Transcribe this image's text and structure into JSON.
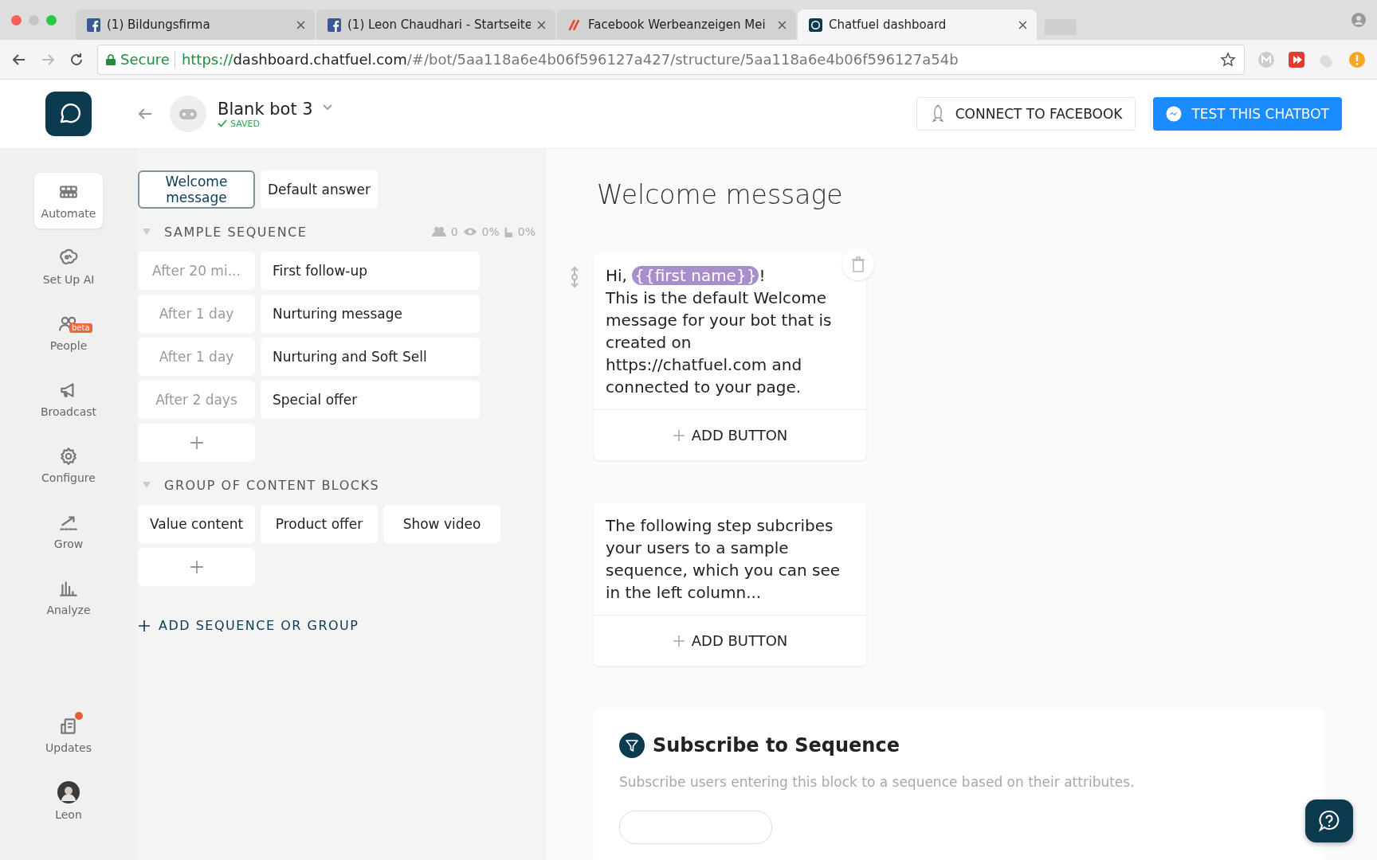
{
  "browser": {
    "tabs": [
      {
        "title": "(1) Bildungsfirma",
        "kind": "facebook",
        "selected": false
      },
      {
        "title": "(1) Leon Chaudhari - Startseite",
        "kind": "facebook",
        "selected": false
      },
      {
        "title": "Facebook Werbeanzeigen Mei",
        "kind": "adobe",
        "selected": false
      },
      {
        "title": "Chatfuel dashboard",
        "kind": "chatfuel",
        "selected": true
      }
    ],
    "secure_label": "Secure",
    "url_scheme": "https://",
    "url_host": "dashboard.chatfuel.com",
    "url_path": "/#/bot/5aa118a6e4b06f596127a427/structure/5aa118a6e4b06f596127a54b"
  },
  "header": {
    "bot_name": "Blank bot 3",
    "status": "SAVED",
    "connect_button": "CONNECT TO FACEBOOK",
    "test_button": "TEST THIS CHATBOT"
  },
  "sidebar": {
    "items": [
      {
        "label": "Automate",
        "kind": "automate",
        "selected": true
      },
      {
        "label": "Set Up AI",
        "kind": "ai",
        "selected": false
      },
      {
        "label": "People",
        "kind": "people",
        "selected": false,
        "badge": "beta"
      },
      {
        "label": "Broadcast",
        "kind": "broadcast",
        "selected": false
      },
      {
        "label": "Configure",
        "kind": "configure",
        "selected": false
      },
      {
        "label": "Grow",
        "kind": "grow",
        "selected": false
      },
      {
        "label": "Analyze",
        "kind": "analyze",
        "selected": false
      }
    ],
    "bottom_items": [
      {
        "label": "Updates",
        "kind": "updates",
        "notification": true
      },
      {
        "label": "Leon",
        "kind": "avatar",
        "notification": false
      }
    ]
  },
  "blocks_panel": {
    "top_blocks": [
      {
        "label": "Welcome message",
        "selected": true
      },
      {
        "label": "Default answer",
        "selected": false
      }
    ],
    "groups": [
      {
        "title": "SAMPLE SEQUENCE",
        "kind": "sequence",
        "expanded": true,
        "stats": [
          "0",
          "0%",
          "0%"
        ],
        "rows": [
          {
            "delay": "After 20 mi...",
            "title": "First follow-up"
          },
          {
            "delay": "After 1 day",
            "title": "Nurturing message"
          },
          {
            "delay": "After 1 day",
            "title": "Nurturing and Soft Sell"
          },
          {
            "delay": "After 2 days",
            "title": "Special offer"
          }
        ]
      },
      {
        "title": "GROUP OF CONTENT BLOCKS",
        "kind": "group",
        "expanded": true,
        "blocks": [
          "Value content",
          "Product offer",
          "Show video"
        ]
      }
    ],
    "add_link": "ADD SEQUENCE OR GROUP"
  },
  "editor": {
    "title": "Welcome message",
    "cards": [
      {
        "kind": "text",
        "first_line": [
          {
            "text": "Hi, "
          },
          {
            "text": "{{first name}}",
            "variable": true
          },
          {
            "text": "!"
          }
        ],
        "body": "This is the default Welcome message for your bot that is created on https://chatfuel.com and connected to your page.",
        "button": "ADD BUTTON",
        "deletable": true
      },
      {
        "kind": "text",
        "body": "The following step subcribes your users to a sample sequence, which you can see in the left column...",
        "button": "ADD BUTTON",
        "deletable": false
      },
      {
        "kind": "plugin",
        "title": "Subscribe to Sequence",
        "description": "Subscribe users entering this block to a sequence based on their attributes."
      }
    ]
  }
}
